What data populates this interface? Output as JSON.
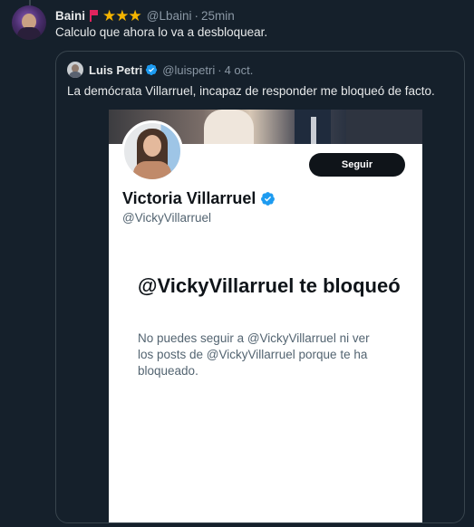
{
  "tweet": {
    "author_name": "Baini",
    "author_handle": "@Lbaini",
    "time": "25min",
    "text": "Calculo que ahora lo va a desbloquear.",
    "stars": "★★★",
    "flag_color": "#e0245e",
    "star_color": "#f4b400"
  },
  "quoted": {
    "author_name": "Luis Petri",
    "author_handle": "@luispetri",
    "date": "4 oct.",
    "text": "La demócrata Villarruel, incapaz de responder me bloqueó de facto."
  },
  "screenshot": {
    "profile_name": "Victoria Villarruel",
    "profile_handle": "@VickyVillarruel",
    "follow_label": "Seguir",
    "blocked_title": "@VickyVillarruel te bloqueó",
    "blocked_description": "No puedes seguir a @VickyVillarruel ni ver los posts de @VickyVillarruel porque te ha bloqueado."
  },
  "colors": {
    "background": "#15202b",
    "verified": "#1d9bf0"
  },
  "icons": {
    "verified": "verified-badge-icon",
    "flag": "flag-icon",
    "stars": "star-icon"
  }
}
